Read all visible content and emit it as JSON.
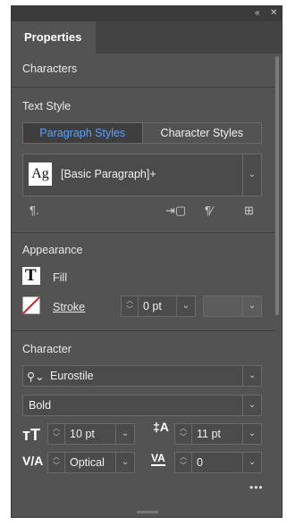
{
  "window": {
    "collapse_icon": "«",
    "close_icon": "✕"
  },
  "tabs": [
    {
      "label": "Properties",
      "active": true
    }
  ],
  "sections": {
    "characters": {
      "title": "Characters"
    },
    "text_style": {
      "title": "Text Style",
      "segments": [
        "Paragraph Styles",
        "Character Styles"
      ],
      "active_segment": "Paragraph Styles",
      "selected_style": "[Basic Paragraph]+",
      "preview_glyph": "Ag"
    },
    "appearance": {
      "title": "Appearance",
      "fill_label": "Fill",
      "stroke_label": "Stroke",
      "stroke_weight": "0 pt"
    },
    "character": {
      "title": "Character",
      "font_family": "Eurostile",
      "font_style": "Bold",
      "font_size": "10 pt",
      "leading": "11 pt",
      "kerning": "Optical",
      "tracking": "0"
    }
  },
  "more_icon": "•••",
  "colors": {
    "panel_bg": "#535353",
    "active_segment_text": "#5aa0ff",
    "stroke_none": "#e02020"
  }
}
